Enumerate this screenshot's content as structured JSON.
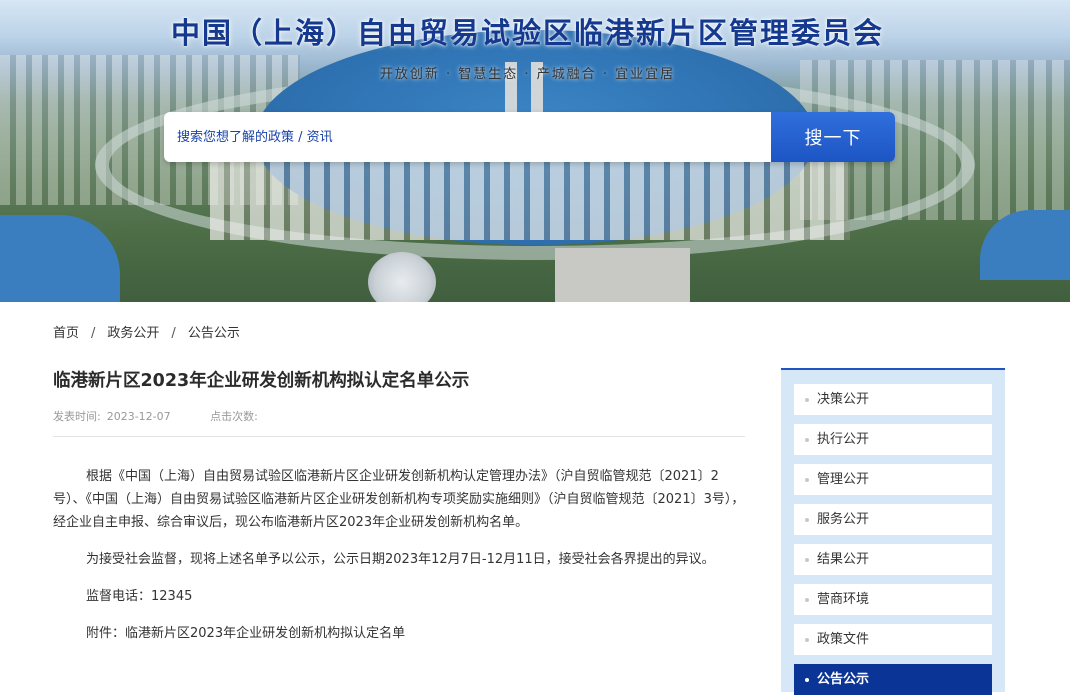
{
  "header": {
    "site_title": "中国（上海）自由贸易试验区临港新片区管理委员会",
    "slogan": "开放创新 · 智慧生态 · 产城融合 · 宜业宜居"
  },
  "search": {
    "placeholder": "搜索您想了解的政策 / 资讯",
    "button_label": "搜一下"
  },
  "breadcrumb": {
    "items": [
      "首页",
      "政务公开",
      "公告公示"
    ],
    "separator": "/"
  },
  "article": {
    "title": "临港新片区2023年企业研发创新机构拟认定名单公示",
    "publish_label": "发表时间:",
    "publish_date": "2023-12-07",
    "views_label": "点击次数:",
    "paragraphs": [
      "根据《中国（上海）自由贸易试验区临港新片区企业研发创新机构认定管理办法》（沪自贸临管规范〔2021〕2号）、《中国（上海）自由贸易试验区临港新片区企业研发创新机构专项奖励实施细则》（沪自贸临管规范〔2021〕3号），经企业自主申报、综合审议后，现公布临港新片区2023年企业研发创新机构名单。",
      "为接受社会监督，现将上述名单予以公示，公示日期2023年12月7日-12月11日，接受社会各界提出的异议。",
      "监督电话：12345",
      "附件：临港新片区2023年企业研发创新机构拟认定名单"
    ]
  },
  "side_menu": {
    "items": [
      "决策公开",
      "执行公开",
      "管理公开",
      "服务公开",
      "结果公开",
      "营商环境",
      "政策文件",
      "公告公示"
    ],
    "active_index": 7
  },
  "colors": {
    "title_blue": "#14398f",
    "search_button": "#1d55c4",
    "side_bg": "#d6e7f7",
    "side_active": "#0a3496"
  }
}
